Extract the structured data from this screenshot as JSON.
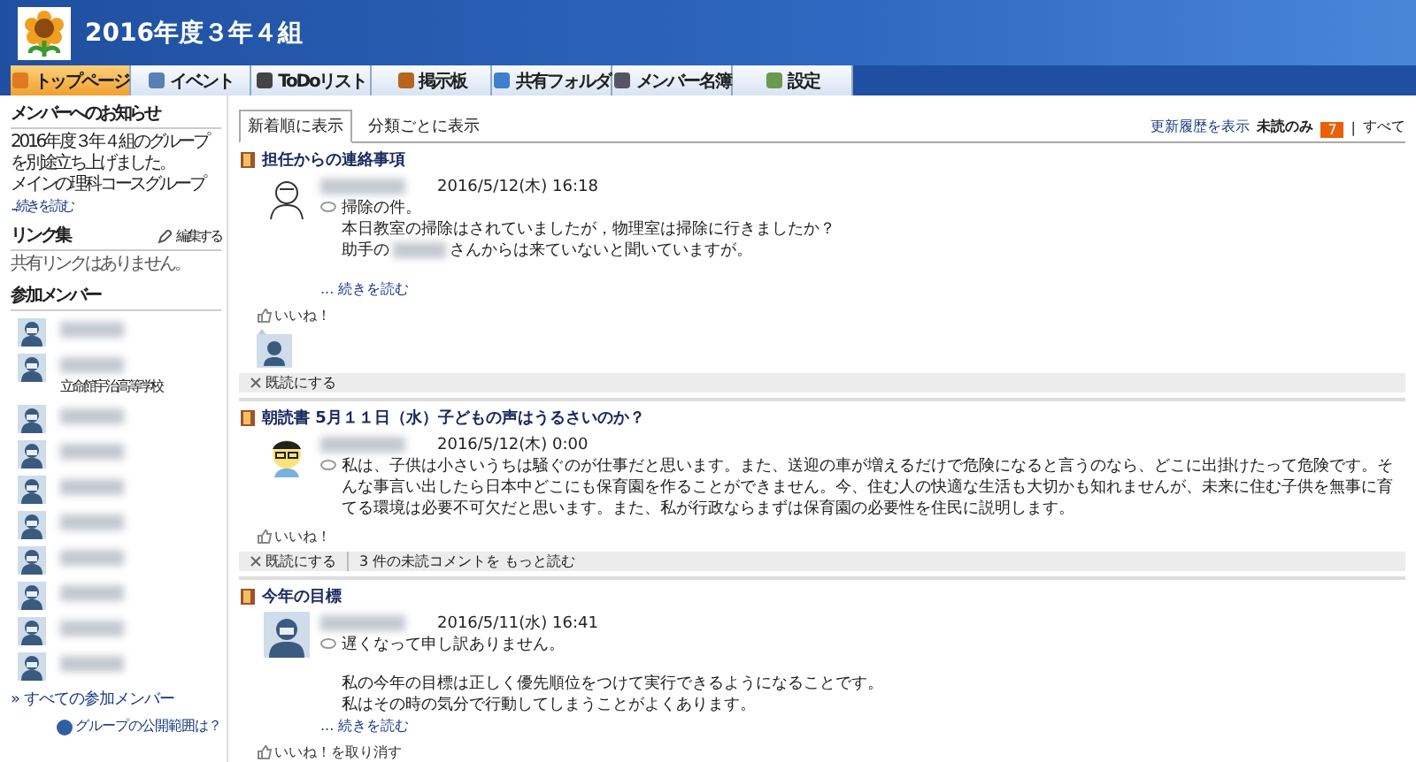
{
  "header": {
    "title": "2016年度３年４組"
  },
  "nav": [
    {
      "label": "トップページ",
      "selected": true
    },
    {
      "label": "イベント",
      "selected": false
    },
    {
      "label": "ToDoリスト",
      "selected": false
    },
    {
      "label": "掲示板",
      "selected": false
    },
    {
      "label": "共有フォルダ",
      "selected": false
    },
    {
      "label": "メンバー名簿",
      "selected": false
    },
    {
      "label": "設定",
      "selected": false
    }
  ],
  "sidebar": {
    "notice": {
      "heading": "メンバーへのお知らせ",
      "lines": [
        "2016年度３年４組のグループ",
        "を別途立ち上げました。",
        "メインの理科コースグループ"
      ],
      "more": "...続きを読む"
    },
    "links": {
      "heading": "リンク集",
      "edit": "編集する",
      "empty": "共有リンクはありません。"
    },
    "members": {
      "heading": "参加メンバー",
      "items": [
        {
          "kind": "member"
        },
        {
          "kind": "member",
          "school": "立命館宇治高等学校"
        },
        {
          "kind": "member"
        },
        {
          "kind": "member"
        },
        {
          "kind": "member"
        },
        {
          "kind": "member"
        },
        {
          "kind": "member"
        },
        {
          "kind": "member"
        },
        {
          "kind": "member"
        },
        {
          "kind": "member"
        }
      ],
      "all": "» すべての参加メンバー",
      "help": "グループの公開範囲は？"
    }
  },
  "tabs": [
    {
      "label": "新着順に表示",
      "selected": true
    },
    {
      "label": "分類ごとに表示",
      "selected": false
    }
  ],
  "toolbar": {
    "history": "更新履歴を表示",
    "unread": "未読のみ",
    "count": "7",
    "sep": "|",
    "all": "すべて"
  },
  "posts": [
    {
      "title": "担任からの連絡事項",
      "avatar": {
        "kind": "sketch"
      },
      "date": "2016/5/12(木) 16:18",
      "lines": [
        {
          "kind": "text",
          "parts": [
            "掃除の件。"
          ]
        },
        {
          "kind": "text",
          "parts": [
            "本日教室の掃除はされていましたが，物理室は掃除に行きましたか？"
          ]
        },
        {
          "kind": "text",
          "parts": [
            "助手の",
            "さんからは来ていないと聞いていますが。"
          ]
        },
        {
          "kind": "blank"
        }
      ],
      "more": "... 続きを読む",
      "like": "いいね！",
      "liked_by": true,
      "actions": [
        "既読にする"
      ]
    },
    {
      "title": "朝読書 5月１１日（水）子どもの声はうるさいのか？",
      "avatar": {
        "kind": "cartoon"
      },
      "date": "2016/5/12(木) 0:00",
      "lines": [
        {
          "kind": "text",
          "parts": [
            "私は、子供は小さいうちは騒ぐのが仕事だと思います。また、送迎の車が増えるだけで危険になると言うのなら、どこに出掛けたって危険です。そんな事言い出したら日本中どこにも保育園を作ることができません。今、住む人の快適な生活も大切かも知れませんが、未来に住む子供を無事に育てる環境は必要不可欠だと思います。また、私が行政ならまずは保育園の必要性を住民に説明します。"
          ]
        }
      ],
      "like": "いいね！",
      "liked_by": false,
      "actions": [
        "既読にする",
        "3 件の未読コメントを もっと読む"
      ]
    },
    {
      "title": "今年の目標",
      "avatar": {
        "kind": "default"
      },
      "date": "2016/5/11(水) 16:41",
      "lines": [
        {
          "kind": "text",
          "parts": [
            "遅くなって申し訳ありません。"
          ]
        },
        {
          "kind": "blank"
        },
        {
          "kind": "text",
          "parts": [
            "私の今年の目標は正しく優先順位をつけて実行できるようになることです。"
          ]
        },
        {
          "kind": "text",
          "parts": [
            "私はその時の気分で行動してしまうことがよくあります。"
          ]
        }
      ],
      "more": "... 続きを読む",
      "like": "いいね！を取り消す",
      "liked_by": false
    }
  ]
}
